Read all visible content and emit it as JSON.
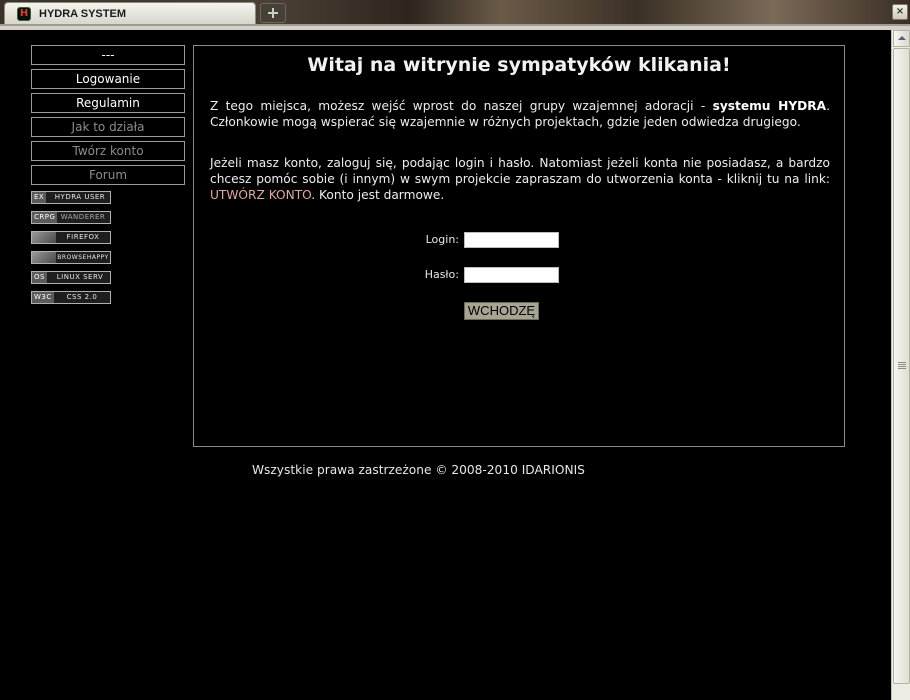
{
  "browser": {
    "tab_title": "HYDRA SYSTEM",
    "favicon_letter": "H",
    "close_glyph": "×"
  },
  "sidebar": {
    "items": [
      {
        "label": "---"
      },
      {
        "label": "Logowanie"
      },
      {
        "label": "Regulamin"
      },
      {
        "label": "Jak to działa"
      },
      {
        "label": "Twórz konto"
      },
      {
        "label": "Forum"
      }
    ],
    "badges": [
      {
        "left": "EX",
        "right": "HYDRA USER"
      },
      {
        "left": "CRPG",
        "right": "WANDERER"
      },
      {
        "left": "",
        "right": "FIREFOX"
      },
      {
        "left": "",
        "right": "BROWSEHAPPY"
      },
      {
        "left": "OS",
        "right": "LINUX SERV"
      },
      {
        "left": "W3C",
        "right": "CSS 2.0"
      }
    ]
  },
  "main": {
    "heading": "Witaj na witrynie sympatyków klikania!",
    "para1_start": "Z tego miejsca, możesz wejść wprost do naszej grupy wzajemnej adoracji - ",
    "para1_bold": "systemu HYDRA",
    "para1_end": ". Członkowie mogą wspierać się wzajemnie w różnych projektach, gdzie jeden odwiedza drugiego.",
    "para2_start": "Jeżeli masz konto, zaloguj się, podając login i hasło. Natomiast jeżeli konta nie posiadasz, a bardzo chcesz pomóc sobie (i innym) w swym projekcie zapraszam do utworzenia konta - kliknij tu na link: ",
    "para2_link": "UTWÓRZ KONTO",
    "para2_end": ". Konto jest darmowe.",
    "login_label": "Login:",
    "login_value": "",
    "password_label": "Hasło:",
    "password_value": "",
    "submit_label": "WCHODZĘ"
  },
  "footer": {
    "text": "Wszystkie prawa zastrzeżone © 2008-2010 IDARIONIS"
  },
  "colors": {
    "background": "#000000",
    "link": "#e0a99a",
    "button": "#a8a493"
  }
}
